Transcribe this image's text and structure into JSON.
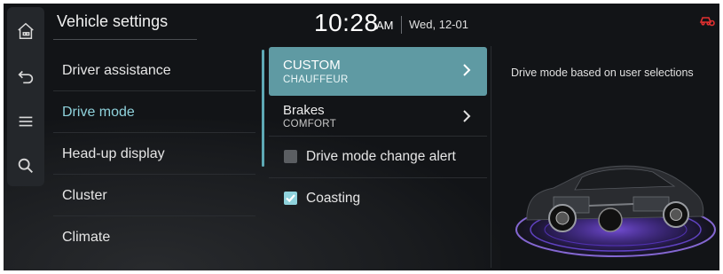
{
  "header": {
    "title": "Vehicle settings",
    "time": "10:28",
    "ampm": "AM",
    "date": "Wed, 12-01"
  },
  "rail": {
    "icons": [
      "home-icon",
      "back-icon",
      "menu-icon",
      "search-icon"
    ]
  },
  "menu": {
    "items": [
      {
        "label": "Driver assistance"
      },
      {
        "label": "Drive mode"
      },
      {
        "label": "Head-up display"
      },
      {
        "label": "Cluster"
      },
      {
        "label": "Climate"
      }
    ],
    "active_index": 1
  },
  "options": {
    "custom": {
      "title": "CUSTOM",
      "sub": "CHAUFFEUR"
    },
    "brakes": {
      "title": "Brakes",
      "sub": "COMFORT"
    },
    "alert": {
      "label": "Drive mode change alert",
      "checked": false
    },
    "coasting": {
      "label": "Coasting",
      "checked": true
    }
  },
  "description": "Drive mode based on user selections",
  "colors": {
    "accent": "#8fd2dc",
    "selected_bg": "#5f9aa3",
    "status_icon": "#e03030"
  }
}
